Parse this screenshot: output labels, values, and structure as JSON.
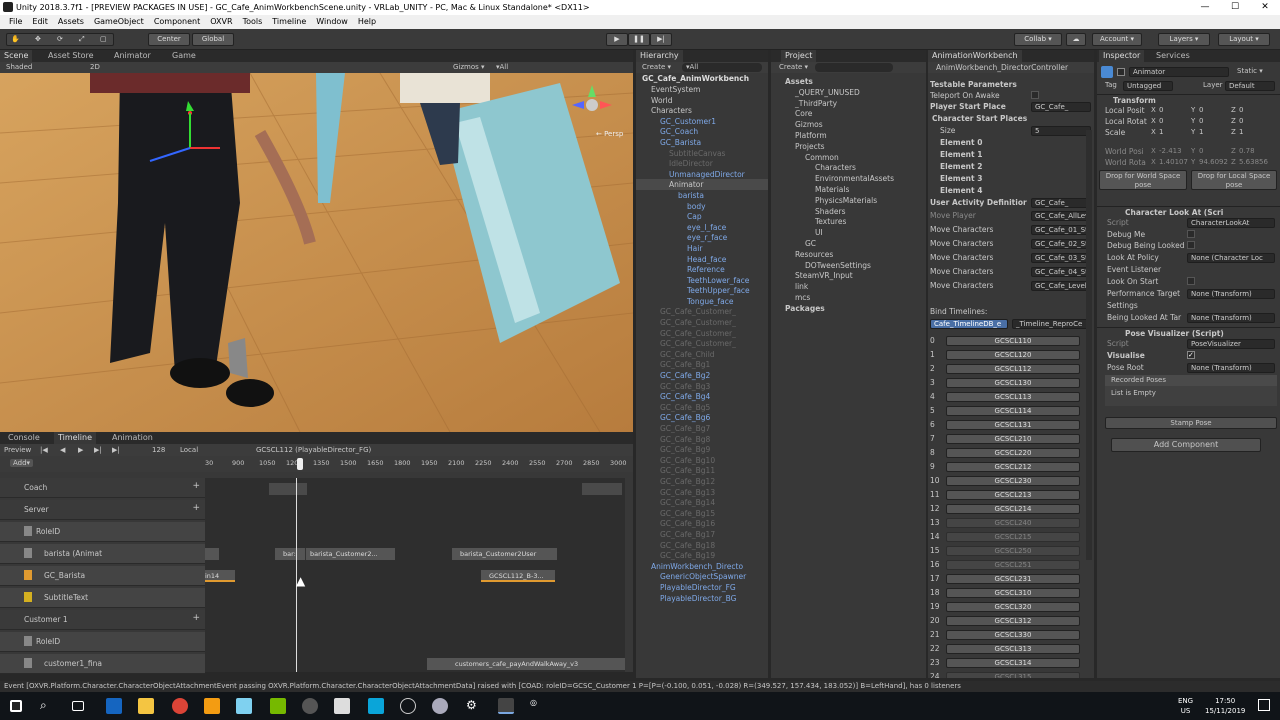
{
  "window": {
    "title": "Unity 2018.3.7f1 - [PREVIEW PACKAGES IN USE] - GC_Cafe_AnimWorkbenchScene.unity - VRLab_UNITY - PC, Mac & Linux Standalone* <DX11>",
    "min": "—",
    "max": "☐",
    "close": "✕"
  },
  "menu": [
    "File",
    "Edit",
    "Assets",
    "GameObject",
    "Component",
    "OXVR",
    "Tools",
    "Timeline",
    "Window",
    "Help"
  ],
  "toolbar": {
    "center": "Center",
    "global": "Global",
    "collab": "Collab ▾",
    "account": "Account ▾",
    "layers": "Layers ▾",
    "layout": "Layout ▾"
  },
  "scene": {
    "tabs": [
      "Scene",
      "Asset Store",
      "Animator",
      "Game"
    ],
    "shaded": "Shaded",
    "mode2d": "2D",
    "gizmos": "Gizmos ▾",
    "search": "▾All",
    "persp": "← Persp"
  },
  "timeline": {
    "tabs": [
      "Console",
      "Timeline",
      "Animation"
    ],
    "preview": "Preview",
    "frame": "128",
    "local": "Local",
    "director": "GCSCL112 (PlayableDirector_FG)",
    "add": "Add▾",
    "ticks": [
      "30",
      "900",
      "1050",
      "1200",
      "1350",
      "1500",
      "1650",
      "1800",
      "1950",
      "2100",
      "2250",
      "2400",
      "2550",
      "2700",
      "2850",
      "3000"
    ],
    "tracks": [
      {
        "label": "Coach",
        "type": "group"
      },
      {
        "label": "Server",
        "type": "group"
      },
      {
        "label": "RoleID",
        "type": "sub"
      },
      {
        "label": "barista (Animat",
        "type": "anim"
      },
      {
        "label": "GC_Barista",
        "type": "ctrl"
      },
      {
        "label": "SubtitleText",
        "type": "text"
      },
      {
        "label": "Customer 1",
        "type": "group"
      },
      {
        "label": "RoleID",
        "type": "sub"
      },
      {
        "label": "customer1_fina",
        "type": "anim"
      }
    ],
    "clips": [
      "bar:",
      "barista_Customer2...",
      "barista_Customer2User",
      "in14",
      "GCSCL112_B-3...",
      "customers_cafe_payAndWalkAway_v3"
    ]
  },
  "hierarchy": {
    "tab": "Hierarchy",
    "create": "Create ▾",
    "search": "▾All",
    "root": "GC_Cafe_AnimWorkbench",
    "items": [
      {
        "t": "EventSystem",
        "d": 1,
        "c": "n"
      },
      {
        "t": "World",
        "d": 1,
        "c": "n"
      },
      {
        "t": "Characters",
        "d": 1,
        "c": "n"
      },
      {
        "t": "GC_Customer1",
        "d": 2,
        "c": "b"
      },
      {
        "t": "GC_Coach",
        "d": 2,
        "c": "b"
      },
      {
        "t": "GC_Barista",
        "d": 2,
        "c": "b"
      },
      {
        "t": "SubtitleCanvas",
        "d": 3,
        "c": "bd"
      },
      {
        "t": "IdleDirector",
        "d": 3,
        "c": "bd"
      },
      {
        "t": "UnmanagedDirector",
        "d": 3,
        "c": "b"
      },
      {
        "t": "Animator",
        "d": 3,
        "c": "n"
      },
      {
        "t": "barista",
        "d": 4,
        "c": "b"
      },
      {
        "t": "body",
        "d": 5,
        "c": "b"
      },
      {
        "t": "Cap",
        "d": 5,
        "c": "b"
      },
      {
        "t": "eye_l_face",
        "d": 5,
        "c": "b"
      },
      {
        "t": "eye_r_face",
        "d": 5,
        "c": "b"
      },
      {
        "t": "Hair",
        "d": 5,
        "c": "b"
      },
      {
        "t": "Head_face",
        "d": 5,
        "c": "b"
      },
      {
        "t": "Reference",
        "d": 5,
        "c": "b"
      },
      {
        "t": "TeethLower_face",
        "d": 5,
        "c": "b"
      },
      {
        "t": "TeethUpper_face",
        "d": 5,
        "c": "b"
      },
      {
        "t": "Tongue_face",
        "d": 5,
        "c": "b"
      },
      {
        "t": "GC_Cafe_Customer_",
        "d": 2,
        "c": "bd"
      },
      {
        "t": "GC_Cafe_Customer_",
        "d": 2,
        "c": "bd"
      },
      {
        "t": "GC_Cafe_Customer_",
        "d": 2,
        "c": "bd"
      },
      {
        "t": "GC_Cafe_Customer_",
        "d": 2,
        "c": "bd"
      },
      {
        "t": "GC_Cafe_Child",
        "d": 2,
        "c": "bd"
      },
      {
        "t": "GC_Cafe_Bg1",
        "d": 2,
        "c": "bd"
      },
      {
        "t": "GC_Cafe_Bg2",
        "d": 2,
        "c": "b"
      },
      {
        "t": "GC_Cafe_Bg3",
        "d": 2,
        "c": "bd"
      },
      {
        "t": "GC_Cafe_Bg4",
        "d": 2,
        "c": "b"
      },
      {
        "t": "GC_Cafe_Bg5",
        "d": 2,
        "c": "bd"
      },
      {
        "t": "GC_Cafe_Bg6",
        "d": 2,
        "c": "b"
      },
      {
        "t": "GC_Cafe_Bg7",
        "d": 2,
        "c": "bd"
      },
      {
        "t": "GC_Cafe_Bg8",
        "d": 2,
        "c": "bd"
      },
      {
        "t": "GC_Cafe_Bg9",
        "d": 2,
        "c": "bd"
      },
      {
        "t": "GC_Cafe_Bg10",
        "d": 2,
        "c": "bd"
      },
      {
        "t": "GC_Cafe_Bg11",
        "d": 2,
        "c": "bd"
      },
      {
        "t": "GC_Cafe_Bg12",
        "d": 2,
        "c": "bd"
      },
      {
        "t": "GC_Cafe_Bg13",
        "d": 2,
        "c": "bd"
      },
      {
        "t": "GC_Cafe_Bg14",
        "d": 2,
        "c": "bd"
      },
      {
        "t": "GC_Cafe_Bg15",
        "d": 2,
        "c": "bd"
      },
      {
        "t": "GC_Cafe_Bg16",
        "d": 2,
        "c": "bd"
      },
      {
        "t": "GC_Cafe_Bg17",
        "d": 2,
        "c": "bd"
      },
      {
        "t": "GC_Cafe_Bg18",
        "d": 2,
        "c": "bd"
      },
      {
        "t": "GC_Cafe_Bg19",
        "d": 2,
        "c": "bd"
      },
      {
        "t": "AnimWorkbench_Directo",
        "d": 1,
        "c": "b"
      },
      {
        "t": "GenericObjectSpawner",
        "d": 2,
        "c": "b"
      },
      {
        "t": "PlayableDirector_FG",
        "d": 2,
        "c": "b"
      },
      {
        "t": "PlayableDirector_BG",
        "d": 2,
        "c": "b"
      }
    ]
  },
  "project": {
    "tab": "Project",
    "create": "Create ▾",
    "items": [
      {
        "t": "Assets",
        "d": 0,
        "b": 1
      },
      {
        "t": "_QUERY_UNUSED",
        "d": 1
      },
      {
        "t": "_ThirdParty",
        "d": 1
      },
      {
        "t": "Core",
        "d": 1
      },
      {
        "t": "Gizmos",
        "d": 1
      },
      {
        "t": "Platform",
        "d": 1
      },
      {
        "t": "Projects",
        "d": 1
      },
      {
        "t": "Common",
        "d": 2
      },
      {
        "t": "Characters",
        "d": 3
      },
      {
        "t": "EnvironmentalAssets",
        "d": 3
      },
      {
        "t": "Materials",
        "d": 3
      },
      {
        "t": "PhysicsMaterials",
        "d": 3
      },
      {
        "t": "Shaders",
        "d": 3
      },
      {
        "t": "Textures",
        "d": 3
      },
      {
        "t": "UI",
        "d": 3
      },
      {
        "t": "GC",
        "d": 2
      },
      {
        "t": "Resources",
        "d": 1
      },
      {
        "t": "DOTweenSettings",
        "d": 2
      },
      {
        "t": "SteamVR_Input",
        "d": 1
      },
      {
        "t": "link",
        "d": 1
      },
      {
        "t": "mcs",
        "d": 1
      },
      {
        "t": "Packages",
        "d": 0,
        "b": 1
      }
    ]
  },
  "workbench": {
    "tab": "AnimationWorkbench",
    "controller": "AnimWorkbench_DirectorController",
    "testable": "Testable Parameters",
    "teleport": "Teleport On Awake",
    "playerStart": "Player Start Place",
    "playerStartVal": "GC_Cafe_",
    "charStart": "Character Start Places",
    "size": "Size",
    "sizeVal": "5",
    "elements": [
      "Element 0",
      "Element 1",
      "Element 2",
      "Element 3",
      "Element 4"
    ],
    "userActivity": "User Activity Definitior",
    "userActivityVal": "GC_Cafe_",
    "moves": [
      {
        "l": "Move Player",
        "v": "GC_Cafe_AllLev",
        "dim": true
      },
      {
        "l": "Move Characters",
        "v": "GC_Cafe_01_St"
      },
      {
        "l": "Move Characters",
        "v": "GC_Cafe_02_St"
      },
      {
        "l": "Move Characters",
        "v": "GC_Cafe_03_St"
      },
      {
        "l": "Move Characters",
        "v": "GC_Cafe_04_St"
      },
      {
        "l": "Move Characters",
        "v": "GC_Cafe_LevelE"
      }
    ],
    "bind": "Bind Timelines:",
    "bindTabs": [
      "Cafe_TimelineDB_e",
      "_Timeline_ReproCe"
    ],
    "timelines": [
      "GCSCL110",
      "GCSCL120",
      "GCSCL112",
      "GCSCL130",
      "GCSCL113",
      "GCSCL114",
      "GCSCL131",
      "GCSCL210",
      "GCSCL220",
      "GCSCL212",
      "GCSCL230",
      "GCSCL213",
      "GCSCL214",
      "GCSCL240",
      "GCSCL215",
      "GCSCL250",
      "GCSCL251",
      "GCSCL231",
      "GCSCL310",
      "GCSCL320",
      "GCSCL312",
      "GCSCL330",
      "GCSCL313",
      "GCSCL314",
      "GCSCL315"
    ],
    "dimIdx": [
      13,
      14,
      15,
      16,
      24
    ]
  },
  "inspector": {
    "tabs": [
      "Inspector",
      "Services"
    ],
    "name": "Animator",
    "static": "Static ▾",
    "tag": "Tag",
    "tagVal": "Untagged",
    "layer": "Layer",
    "layerVal": "Default",
    "transform": "Transform",
    "lpos": "Local Posit",
    "lrot": "Local Rotat",
    "scale": "Scale",
    "posv": [
      "0",
      "0",
      "0"
    ],
    "rotv": [
      "0",
      "0",
      "0"
    ],
    "scalev": [
      "1",
      "1",
      "1"
    ],
    "wpos": "World Posi",
    "wrot": "World Rota",
    "wposv": [
      "-2.413",
      "0",
      "0.78"
    ],
    "wrotv": [
      "1.40107",
      "94.6092",
      "5.63856"
    ],
    "dropWorld": "Drop for World Space pose",
    "dropLocal": "Drop for Local Space pose",
    "charLook": "Character Look At (Scri",
    "script": "Script",
    "charLookScript": "CharacterLookAt",
    "debugMe": "Debug Me",
    "debugLooked": "Debug Being Looked",
    "lookPolicy": "Look At Policy",
    "lookPolicyVal": "None (Character Loc",
    "eventListener": "Event Listener",
    "lookStart": "Look On Start",
    "perfTarget": "Performance Target",
    "perfVal": "None (Transform)",
    "settings": "Settings",
    "beingLooked": "Being Looked At Tar",
    "beingVal": "None (Transform)",
    "poseVis": "Pose Visualizer (Script)",
    "poseScript": "PoseVisualizer",
    "visualise": "Visualise",
    "poseRoot": "Pose Root",
    "poseRootVal": "None (Transform)",
    "recorded": "Recorded Poses",
    "empty": "List is Empty",
    "stamp": "Stamp Pose",
    "addComp": "Add Component"
  },
  "status": "Event [OXVR.Platform.Character.CharacterObjectAttachmentEvent passing OXVR.Platform.Character.CharacterObjectAttachmentData] raised with [COAD: roleID=GCSC_Customer 1 P=[P=(-0.100, 0.051, -0.028) R=(349.527, 157.434, 183.052)] B=LeftHand], has 0 listeners",
  "taskbar": {
    "lang": "ENG",
    "region": "US",
    "time": "17:50",
    "date": "15/11/2019"
  }
}
